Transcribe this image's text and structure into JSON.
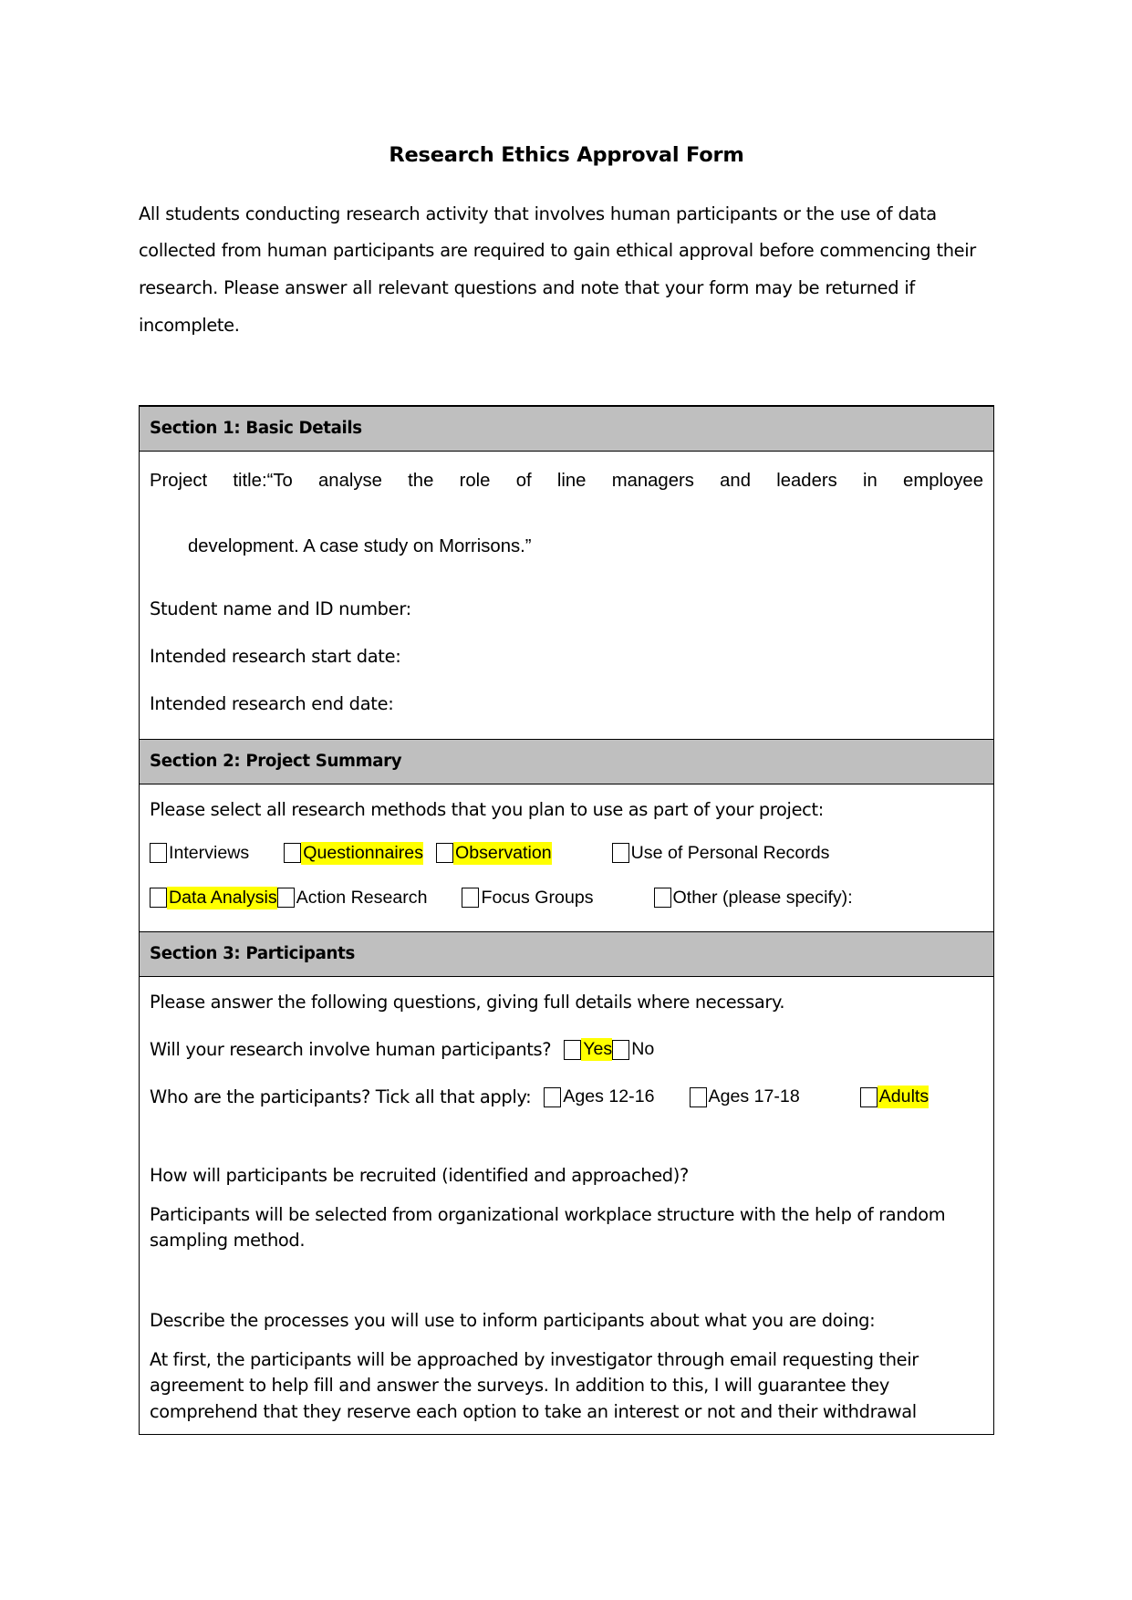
{
  "document": {
    "title": "Research Ethics Approval Form",
    "intro": "All students conducting research activity that involves human participants or the use of data collected from human participants are required to gain ethical approval before commencing their research. Please answer all relevant questions and note that your form may be returned if incomplete."
  },
  "section1": {
    "header": "Section 1: Basic Details",
    "project_title_label": "Project title:“",
    "project_title_line1": "To analyse the role of line managers and leaders in employee",
    "project_title_line2": "development. A case study on Morrisons.”",
    "student_name_label": "Student name and ID number:",
    "start_date_label": "Intended research start date:",
    "end_date_label": "Intended research end date:"
  },
  "section2": {
    "header": "Section 2: Project Summary",
    "intro": "Please select all research methods that you plan to use as part of your project:",
    "methods_row1": [
      {
        "label": "Interviews",
        "highlighted": false
      },
      {
        "label": "Questionnaires",
        "highlighted": true
      },
      {
        "label": "Observation",
        "highlighted": true
      },
      {
        "label": "Use of Personal Records",
        "highlighted": false
      }
    ],
    "methods_row2": [
      {
        "label": "Data Analysis",
        "highlighted": true
      },
      {
        "label": "Action Research",
        "highlighted": false
      },
      {
        "label": "Focus Groups",
        "highlighted": false
      },
      {
        "label": "Other (please specify):",
        "highlighted": false
      }
    ]
  },
  "section3": {
    "header": "Section 3: Participants",
    "intro": "Please answer the following questions, giving full details where necessary.",
    "human_participants_question": "Will your research involve human participants?",
    "human_participants_options": [
      {
        "label": "Yes",
        "highlighted": true
      },
      {
        "label": "No",
        "highlighted": false
      }
    ],
    "who_question": "Who are the participants? Tick all that apply:",
    "who_options": [
      {
        "label": "Ages 12-16",
        "highlighted": false
      },
      {
        "label": "Ages 17-18",
        "highlighted": false
      },
      {
        "label": "Adults",
        "highlighted": true
      }
    ],
    "recruit_question": "How will participants be recruited (identified and approached)?",
    "recruit_answer": "Participants will be selected from organizational workplace structure with the help of random sampling method.",
    "inform_question": "Describe the processes you will use to inform participants about what you are doing:",
    "inform_answer": "At first, the participants will be approached by investigator through email requesting their agreement to help fill and answer the surveys. In addition to this, I will guarantee they comprehend that they reserve each option to take an interest or not and their withdrawal"
  },
  "colors": {
    "section_header_bg": "#bfbfbf",
    "highlight": "#ffff00",
    "border": "#000000",
    "page_bg": "#ffffff"
  }
}
